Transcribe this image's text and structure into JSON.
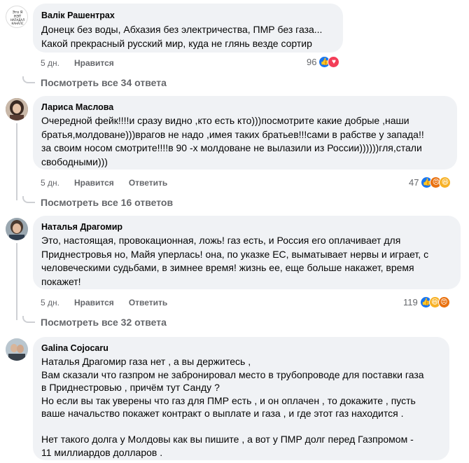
{
  "comments": [
    {
      "author": "Валік Рашентрах",
      "avatar_text": "Это Я НЭТ НАПАДАЛ КАНАЛС",
      "text": "Донецк без воды, Абхазия без электричества, ПМР без газа...\nКакой прекрасный русский мир, куда не глянь везде сортир",
      "time": "5 дн.",
      "like_label": "Нравится",
      "reactions_count": "96",
      "reactions": [
        "like-icon",
        "love-icon"
      ],
      "view_replies": "Посмотреть все 34 ответа"
    },
    {
      "author": "Лариса Маслова",
      "text": "Очередной фейк!!!!и сразу видно ,кто есть кто)))посмотрите какие добрые ,наши\nбратья,молдоване)))врагов не надо ,имея таких братьев!!!сами в рабстве у запада!!\nза своим носом смотрите!!!!в 90 -х молдоване не вылазили из России))))))гля,стали\nсвободными)))",
      "time": "5 дн.",
      "like_label": "Нравится",
      "reply_label": "Ответить",
      "reactions_count": "47",
      "reactions": [
        "like-icon",
        "angry-icon",
        "haha-icon"
      ],
      "view_replies": "Посмотреть все 16 ответов"
    },
    {
      "author": "Наталья Драгомир",
      "text": "Это, настоящая, провокационная, ложь! газ есть, и Россия его оплачивает для\nПриднестровья но, Майя уперлась! она, по указке ЕС, выматывает нервы и играет, с\nчеловеческими судьбами, в зимнее время! жизнь ее, еще больше накажет, время\nпокажет!",
      "time": "5 дн.",
      "like_label": "Нравится",
      "reply_label": "Ответить",
      "reactions_count": "119",
      "reactions": [
        "like-icon",
        "haha-icon",
        "angry-icon"
      ],
      "view_replies": "Посмотреть все 32 ответа"
    },
    {
      "author": "Galina Cojocaru",
      "text": "Наталья Драгомир газа нет , а вы держитесь ,\nВам сказали что газпром не забронировал место в трубопроводе для поставки газа\nв Приднестровью , причём тут Санду ?\nНо если вы так уверены что газ для ПМР есть , и он оплачен , то докажите , пусть\nваше начальство покажет контракт о выплате и газа , и где этот газ находится .\n\nНет такого долга у Молдовы как вы пишите , а вот у ПМР долг перед Газпромом -\n11 миллиардов долларов ."
    }
  ]
}
